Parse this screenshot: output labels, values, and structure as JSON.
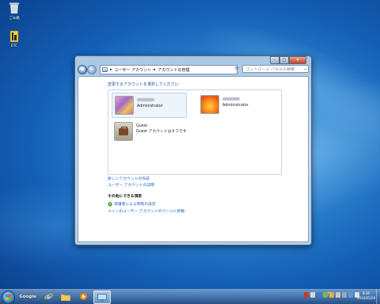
{
  "desktop": {
    "icons": [
      {
        "label": "ごみ箱",
        "icon": "recycle-bin-icon"
      },
      {
        "label": "ETC",
        "icon": "etc-app-icon"
      }
    ]
  },
  "window": {
    "breadcrumb": [
      "ユーザー アカウント",
      "アカウントの管理"
    ],
    "search_placeholder": "コントロール パネルの検索",
    "heading": "変更するアカウントを選択してください",
    "accounts": [
      {
        "role": "Administrator",
        "picture": "butterfly-user-picture"
      },
      {
        "role": "Administrator",
        "picture": "flower-user-picture"
      },
      {
        "name": "Guest",
        "role": "Guest アカウントはオフです",
        "picture": "guest-briefcase-picture"
      }
    ],
    "links": {
      "create_account": "新しいアカウントの作成",
      "what_is_account": "ユーザー アカウントの説明"
    },
    "also_heading": "その他にできる項目",
    "also_links": {
      "parental_controls": "保護者による制限の設定",
      "main_page": "メインのユーザー アカウントのページに移動"
    }
  },
  "taskbar": {
    "google_label": "Google",
    "lang_top": "Latin",
    "lang_bottom": "JP",
    "time": "8:39",
    "date": "2010/05/28"
  }
}
